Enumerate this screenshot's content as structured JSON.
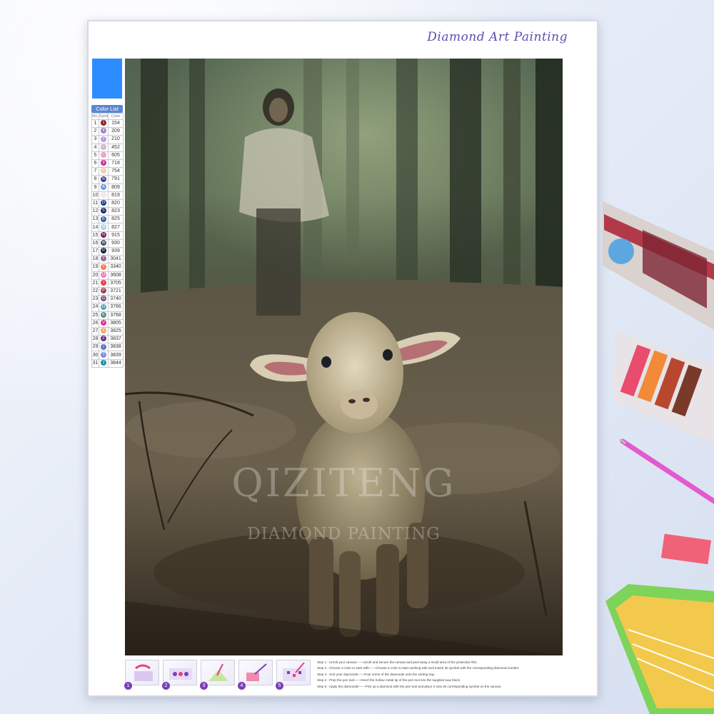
{
  "brand": {
    "title": "Diamond Art Painting"
  },
  "swatch_color": "#2d8cff",
  "color_list": {
    "header": "Color List",
    "columns": [
      "No.",
      "Symbol",
      "Color"
    ],
    "rows": [
      {
        "no": "1",
        "sym": "1",
        "code": "154",
        "color": "#8a1f2b"
      },
      {
        "no": "2",
        "sym": "4",
        "code": "209",
        "color": "#a57fc7"
      },
      {
        "no": "3",
        "sym": "7",
        "code": "210",
        "color": "#b89be0"
      },
      {
        "no": "4",
        "sym": "+",
        "code": "452",
        "color": "#c8b9c6"
      },
      {
        "no": "5",
        "sym": "-",
        "code": "605",
        "color": "#f0a3c0"
      },
      {
        "no": "6",
        "sym": "9",
        "code": "718",
        "color": "#c2309a"
      },
      {
        "no": "7",
        "sym": "#",
        "code": "754",
        "color": "#f2c9a9"
      },
      {
        "no": "8",
        "sym": "%",
        "code": "791",
        "color": "#3b3b8f"
      },
      {
        "no": "9",
        "sym": "A",
        "code": "809",
        "color": "#6e9ad6"
      },
      {
        "no": "10",
        "sym": "C",
        "code": "819",
        "color": "#f7e1e6"
      },
      {
        "no": "11",
        "sym": "D",
        "code": "820",
        "color": "#1e3f8a"
      },
      {
        "no": "12",
        "sym": "S",
        "code": "823",
        "color": "#1b2a5e"
      },
      {
        "no": "13",
        "sym": "B",
        "code": "825",
        "color": "#2e5aa8"
      },
      {
        "no": "14",
        "sym": "M",
        "code": "827",
        "color": "#a9cbe3"
      },
      {
        "no": "15",
        "sym": "N",
        "code": "915",
        "color": "#7a1f54"
      },
      {
        "no": "16",
        "sym": "W",
        "code": "930",
        "color": "#3f5570"
      },
      {
        "no": "17",
        "sym": "R",
        "code": "939",
        "color": "#141c34"
      },
      {
        "no": "18",
        "sym": "T",
        "code": "3041",
        "color": "#8c6b8f"
      },
      {
        "no": "19",
        "sym": "Y",
        "code": "3340",
        "color": "#f07a52"
      },
      {
        "no": "20",
        "sym": "U",
        "code": "3608",
        "color": "#e57fb9"
      },
      {
        "no": "21",
        "sym": "I",
        "code": "3705",
        "color": "#e8404f"
      },
      {
        "no": "22",
        "sym": "P",
        "code": "3721",
        "color": "#9e3f4d"
      },
      {
        "no": "23",
        "sym": "G",
        "code": "3740",
        "color": "#6f5872"
      },
      {
        "no": "24",
        "sym": "H",
        "code": "3766",
        "color": "#4fa3b8"
      },
      {
        "no": "25",
        "sym": "K",
        "code": "3768",
        "color": "#5f8a8c"
      },
      {
        "no": "26",
        "sym": "V",
        "code": "3805",
        "color": "#d4348f"
      },
      {
        "no": "27",
        "sym": "X",
        "code": "3825",
        "color": "#f6a56a"
      },
      {
        "no": "28",
        "sym": "Z",
        "code": "3837",
        "color": "#6a2c87"
      },
      {
        "no": "29",
        "sym": "/",
        "code": "3838",
        "color": "#5d78c0"
      },
      {
        "no": "30",
        "sym": "?",
        "code": "3839",
        "color": "#7b8fd0"
      },
      {
        "no": "31",
        "sym": "J",
        "code": "3844",
        "color": "#1e8fb0"
      }
    ]
  },
  "watermark": {
    "line1": "QIZITENG",
    "line2": "DIAMOND PAINTING"
  },
  "steps": [
    {
      "num": "1"
    },
    {
      "num": "2"
    },
    {
      "num": "3"
    },
    {
      "num": "4"
    },
    {
      "num": "5"
    }
  ],
  "instructions": [
    "Step 1 : Unroll your canvas------Unroll and secure the canvas and peel away a small area of the protective film.",
    "Step 2 : Choose a color to start with------Choose a color to start working with and match its symbol with the corresponding diamond number.",
    "Step 3 : Sort your diamonds------Pour some of the diamonds onto the sorting tray.",
    "Step 4 : Prep the pen tool------Insert the hollow metal tip of the pen tool into the supplied wax block.",
    "Step 5 : Apply the diamonds!------Pick up a diamond with the pen tool and place it onto its corresponding symbol on the canvas."
  ]
}
